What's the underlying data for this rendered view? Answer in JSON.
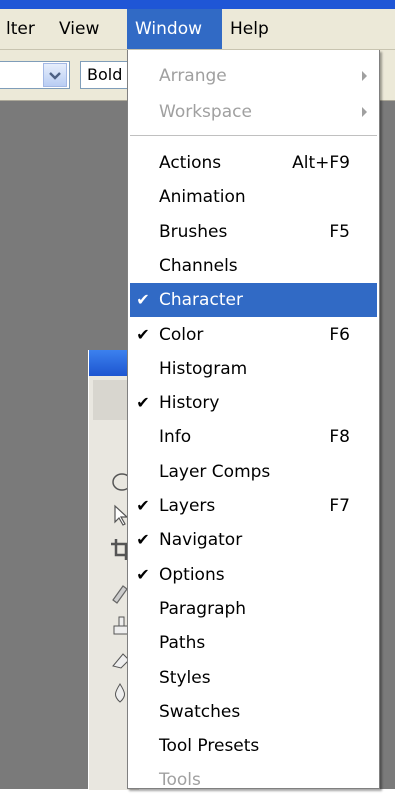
{
  "menubar": {
    "items": [
      {
        "label": "lter"
      },
      {
        "label": "View"
      },
      {
        "label": "Window"
      },
      {
        "label": "Help"
      }
    ]
  },
  "options_bar": {
    "font_style_value": "Bold"
  },
  "window_menu": {
    "group1": [
      {
        "label": "Arrange",
        "submenu": true,
        "disabled": true
      },
      {
        "label": "Workspace",
        "submenu": true,
        "disabled": true
      }
    ],
    "items": [
      {
        "label": "Actions",
        "shortcut": "Alt+F9",
        "checked": false
      },
      {
        "label": "Animation",
        "shortcut": "",
        "checked": false
      },
      {
        "label": "Brushes",
        "shortcut": "F5",
        "checked": false
      },
      {
        "label": "Channels",
        "shortcut": "",
        "checked": false
      },
      {
        "label": "Character",
        "shortcut": "",
        "checked": true,
        "highlighted": true
      },
      {
        "label": "Color",
        "shortcut": "F6",
        "checked": true
      },
      {
        "label": "Histogram",
        "shortcut": "",
        "checked": false
      },
      {
        "label": "History",
        "shortcut": "",
        "checked": true
      },
      {
        "label": "Info",
        "shortcut": "F8",
        "checked": false
      },
      {
        "label": "Layer Comps",
        "shortcut": "",
        "checked": false
      },
      {
        "label": "Layers",
        "shortcut": "F7",
        "checked": true
      },
      {
        "label": "Navigator",
        "shortcut": "",
        "checked": true
      },
      {
        "label": "Options",
        "shortcut": "",
        "checked": true
      },
      {
        "label": "Paragraph",
        "shortcut": "",
        "checked": false
      },
      {
        "label": "Paths",
        "shortcut": "",
        "checked": false
      },
      {
        "label": "Styles",
        "shortcut": "",
        "checked": false
      },
      {
        "label": "Swatches",
        "shortcut": "",
        "checked": false
      },
      {
        "label": "Tool Presets",
        "shortcut": "",
        "checked": false
      },
      {
        "label": "Tools",
        "shortcut": "",
        "checked": false,
        "disabled": true
      }
    ],
    "check_glyph": "✔"
  },
  "colors": {
    "highlight": "#316ac5",
    "menubar_bg": "#ece9d8",
    "disabled_text": "#a0a0a0",
    "workspace": "#7a7a7a"
  }
}
